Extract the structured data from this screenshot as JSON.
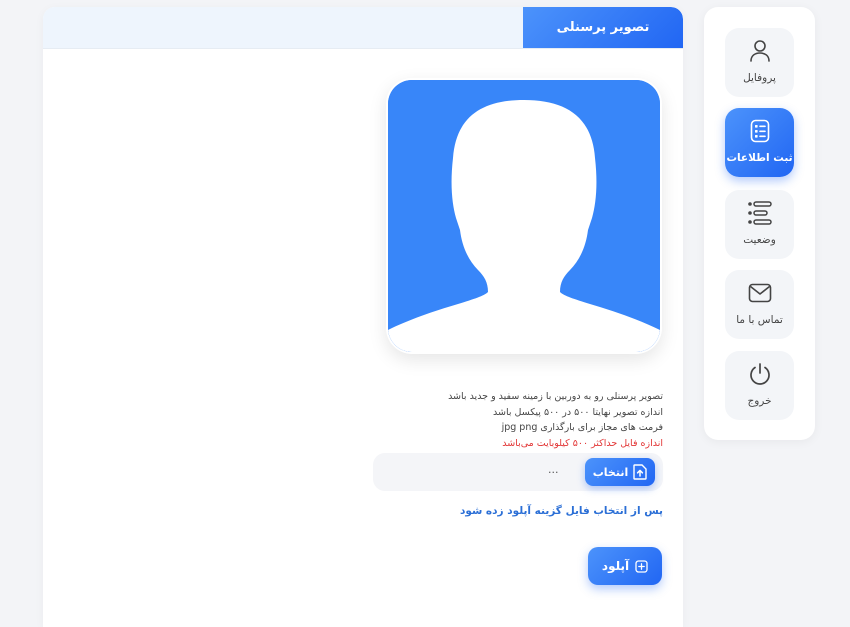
{
  "header": {
    "title": "تصویر پرسنلی"
  },
  "instructions": {
    "line1": "تصویر پرسنلی رو به دوربین با زمینه سفید و جدید باشد",
    "line2": "اندازه تصویر نهایتا ۵۰۰ در ۵۰۰ پیکسل باشد",
    "line3": "فرمت های مجاز برای بارگذاری jpg png",
    "warning": "اندازه فایل حداکثر ۵۰۰ کیلوبایت می‌باشد"
  },
  "file_input": {
    "button_label": "انتخاب",
    "value": "..."
  },
  "upload_hint": "پس از انتخاب فایل گزینه آپلود زده شود",
  "upload_button": {
    "label": "آپلود"
  },
  "sidebar": {
    "items": [
      {
        "label": "پروفایل",
        "icon": "user-icon",
        "active": false
      },
      {
        "label": "ثبت اطلاعات",
        "icon": "form-icon",
        "active": true
      },
      {
        "label": "وضعیت",
        "icon": "list-icon",
        "active": false
      },
      {
        "label": "تماس با ما",
        "icon": "mail-icon",
        "active": false
      },
      {
        "label": "خروج",
        "icon": "power-icon",
        "active": false
      }
    ]
  },
  "colors": {
    "accent": "#2f7cf6",
    "avatar_bg": "#3886f9",
    "warning": "#e23535",
    "hint": "#2b6fd6"
  }
}
